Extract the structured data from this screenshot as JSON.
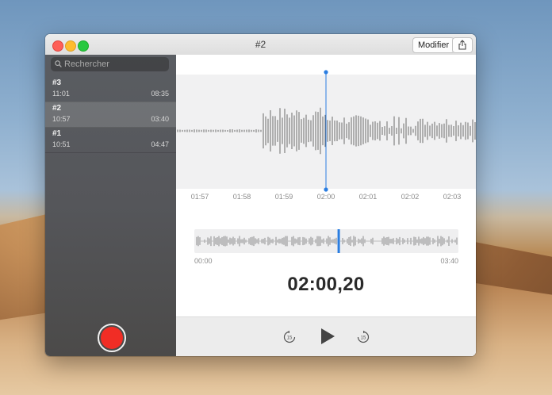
{
  "window": {
    "title": "#2",
    "modifier_label": "Modifier"
  },
  "icons": {
    "share": "share-icon",
    "search": "magnifying-glass-icon",
    "skip_back": "skip-back-15-icon",
    "play": "play-icon",
    "skip_forward": "skip-forward-15-icon",
    "record": "record-icon"
  },
  "sidebar": {
    "search_placeholder": "Rechercher",
    "items": [
      {
        "title": "#3",
        "time": "11:01",
        "duration": "08:35",
        "selected": false
      },
      {
        "title": "#2",
        "time": "10:57",
        "duration": "03:40",
        "selected": true
      },
      {
        "title": "#1",
        "time": "10:51",
        "duration": "04:47",
        "selected": false
      }
    ]
  },
  "player": {
    "timeline_labels": [
      "01:57",
      "01:58",
      "01:59",
      "02:00",
      "02:01",
      "02:02",
      "02:03"
    ],
    "overview_start": "00:00",
    "overview_end": "03:40",
    "current_time": "02:00,20",
    "playhead_fraction": 0.5468
  },
  "colors": {
    "record": "#f12d25",
    "playhead": "#2a7de1",
    "wave": "#6a6a6a",
    "sidebar": "#55565a"
  }
}
